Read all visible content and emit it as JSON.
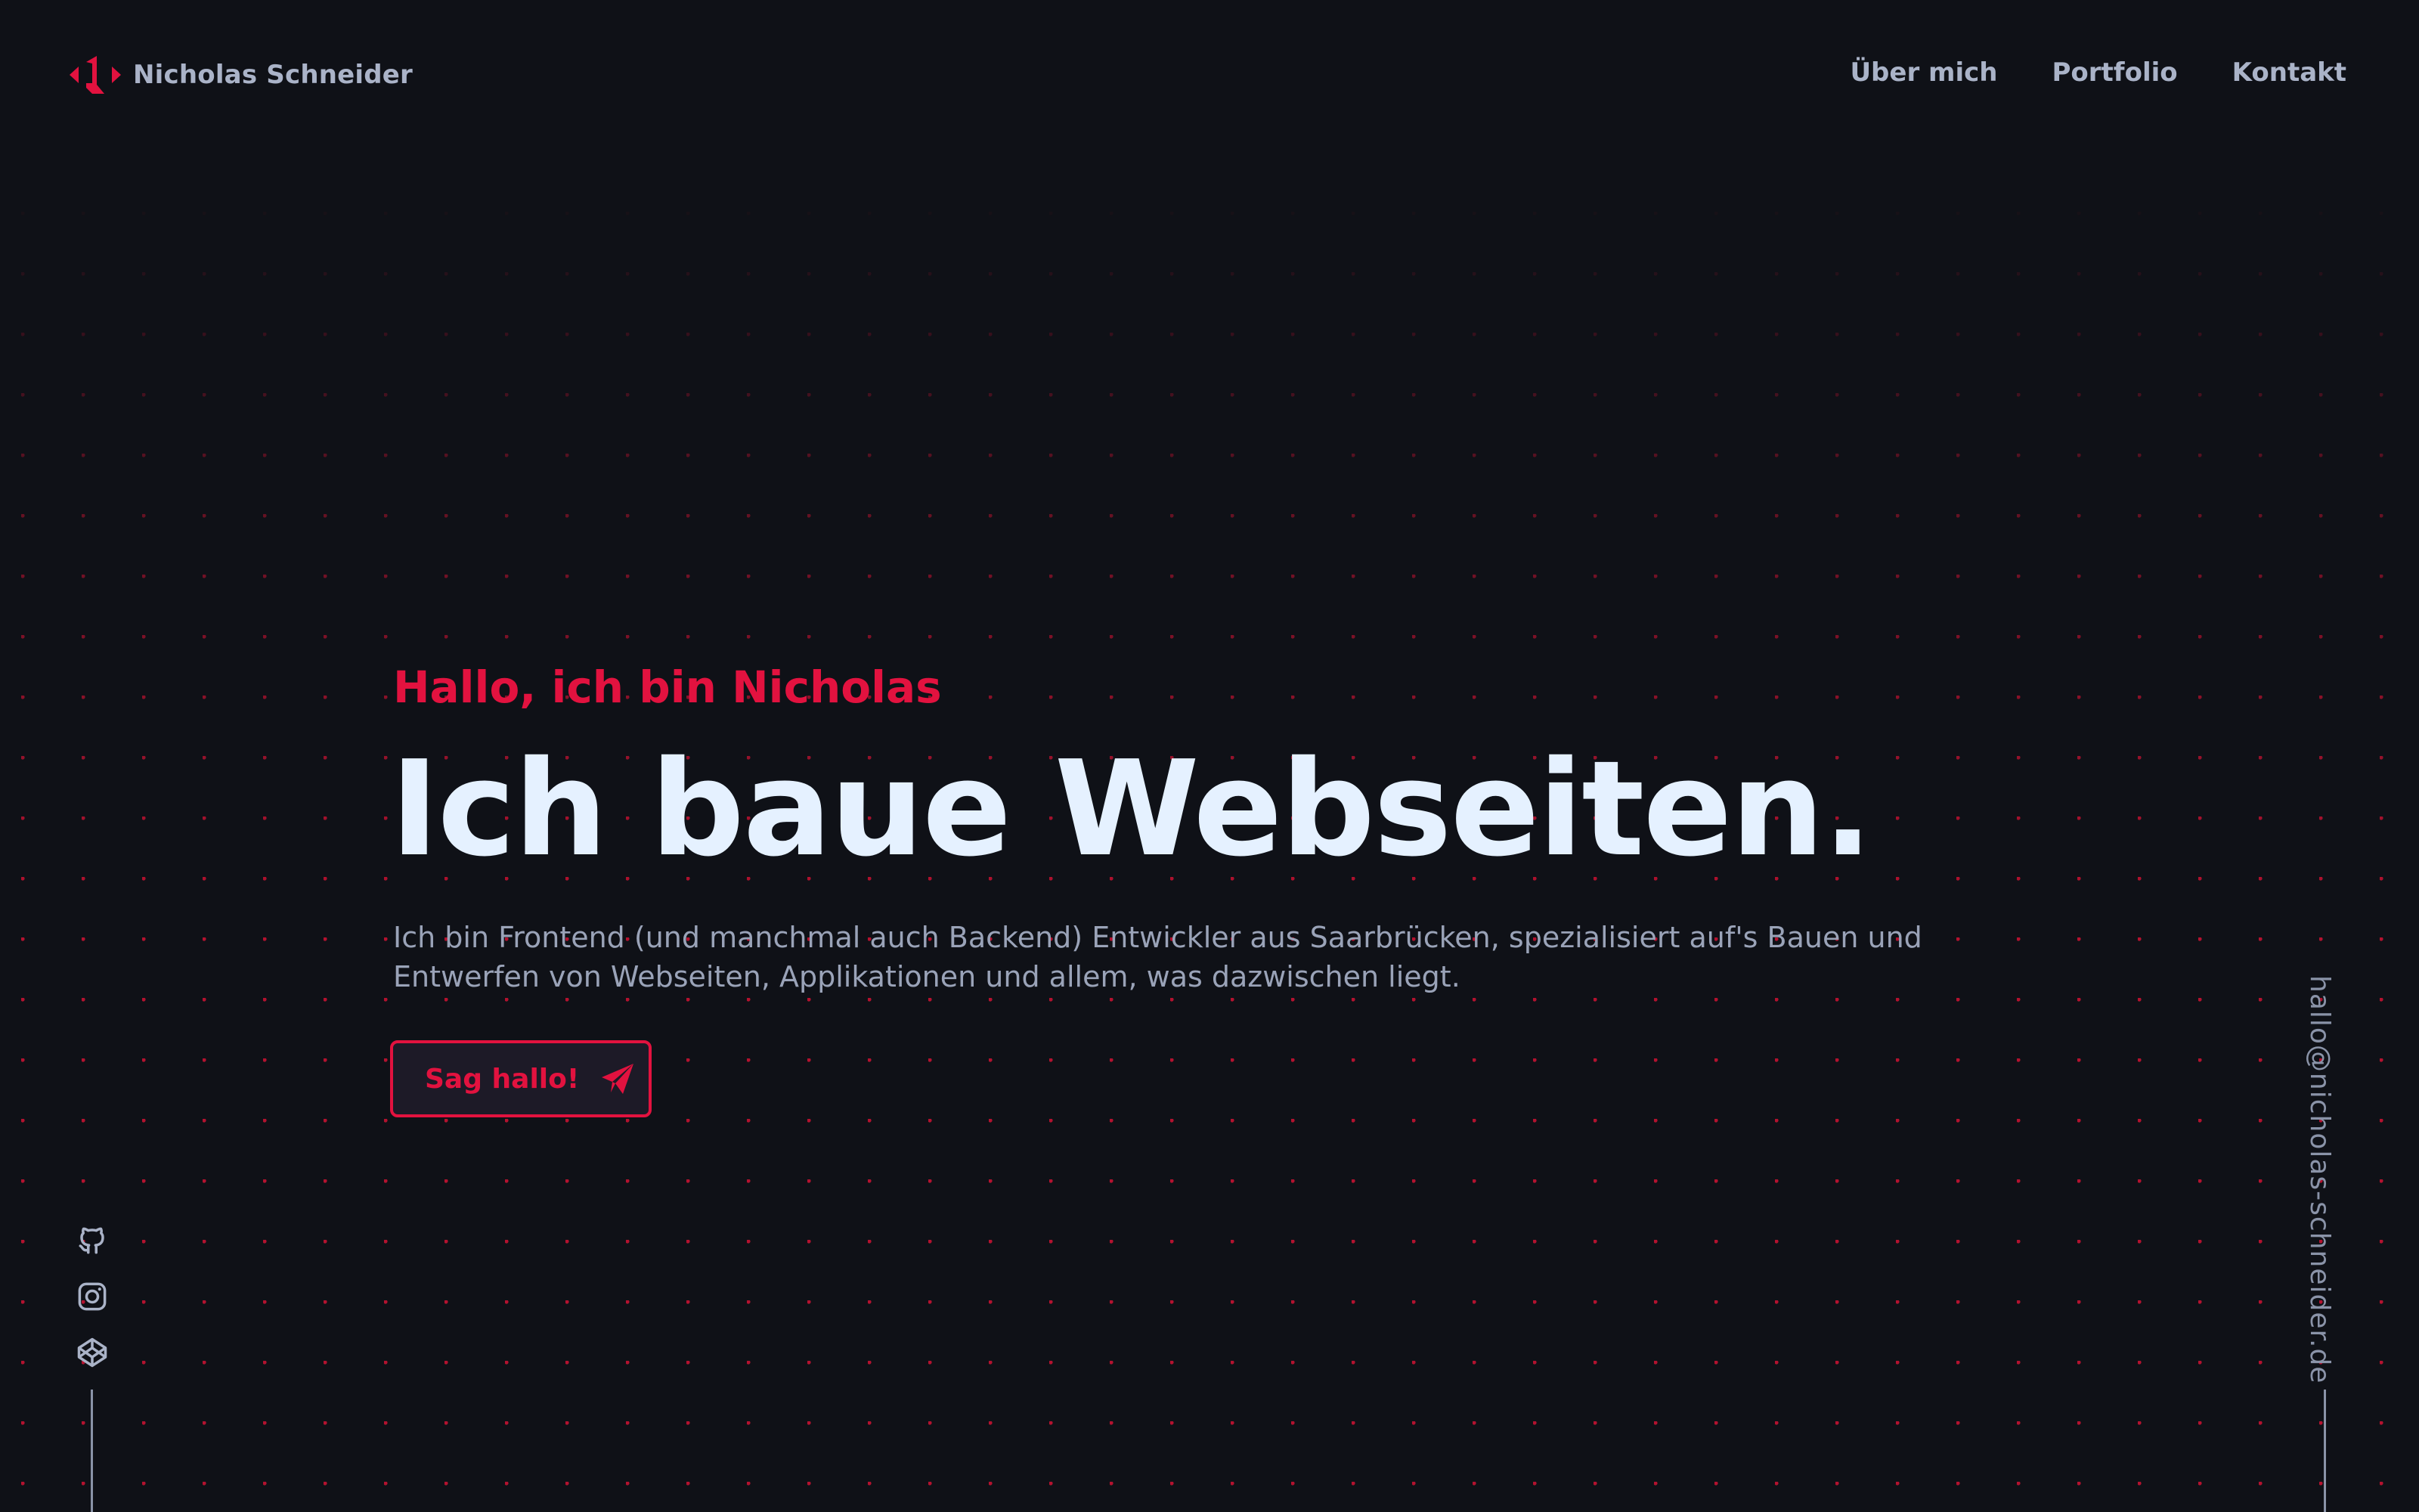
{
  "brand": {
    "name": "Nicholas Schneider",
    "logo_icon": "n-logo-icon",
    "accent_color": "#e2123f"
  },
  "nav": {
    "items": [
      {
        "label": "Über mich"
      },
      {
        "label": "Portfolio"
      },
      {
        "label": "Kontakt"
      }
    ]
  },
  "hero": {
    "greeting": "Hallo, ich bin Nicholas",
    "headline": "Ich baue Webseiten.",
    "intro_line1": "Ich bin Frontend (und manchmal auch Backend) Entwickler aus Saarbrücken, spezialisiert auf's Bauen und",
    "intro_line2": "Entwerfen von Webseiten, Applikationen und allem, was dazwischen liegt.",
    "cta_label": "Sag hallo!",
    "cta_icon": "paper-plane-icon"
  },
  "socials": [
    {
      "icon": "github-icon"
    },
    {
      "icon": "instagram-icon"
    },
    {
      "icon": "codepen-icon"
    }
  ],
  "email": "hallo@nicholas-schneider.de",
  "colors": {
    "background": "#0f1117",
    "text_primary": "#e5f1ff",
    "text_muted": "#9aa3b8",
    "accent": "#e2123f"
  }
}
